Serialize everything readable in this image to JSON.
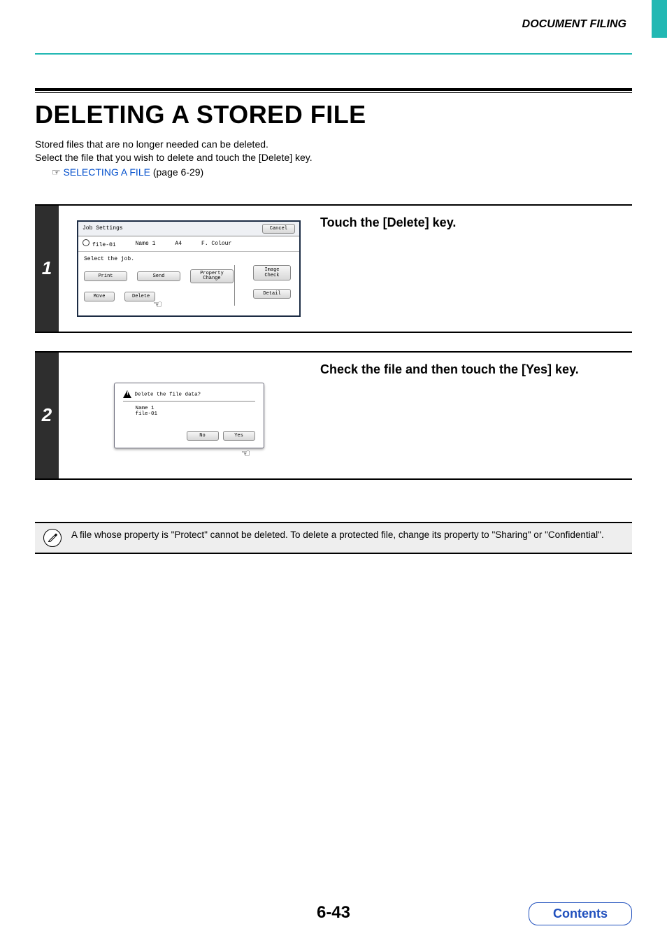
{
  "header": {
    "section": "DOCUMENT FILING"
  },
  "title": "DELETING A STORED FILE",
  "intro": {
    "line1": "Stored files that are no longer needed can be deleted.",
    "line2": "Select the file that you wish to delete and touch the [Delete] key.",
    "link": "SELECTING A FILE",
    "link_after": " (page 6-29)"
  },
  "step1": {
    "num": "1",
    "heading": "Touch the [Delete] key.",
    "panel": {
      "title": "Job Settings",
      "cancel": "Cancel",
      "file": "file-01",
      "name": "Name 1",
      "size": "A4",
      "colour": "F. Colour",
      "prompt": "Select the job.",
      "btn_print": "Print",
      "btn_send": "Send",
      "btn_property": "Property Change",
      "btn_image": "Image Check",
      "btn_move": "Move",
      "btn_delete": "Delete",
      "btn_detail": "Detail"
    }
  },
  "step2": {
    "num": "2",
    "heading": "Check the file and then touch the [Yes] key.",
    "dialog": {
      "question": "Delete the file data?",
      "name": "Name 1",
      "file": "file-01",
      "no": "No",
      "yes": "Yes"
    }
  },
  "note": {
    "text": "A file whose property is \"Protect\" cannot be deleted. To delete a protected file, change its property to \"Sharing\" or \"Confidential\"."
  },
  "footer": {
    "page": "6-43",
    "contents": "Contents"
  }
}
